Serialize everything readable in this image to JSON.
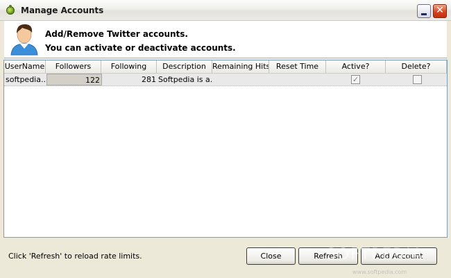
{
  "window": {
    "title": "Manage Accounts"
  },
  "header": {
    "line1": "Add/Remove Twitter accounts.",
    "line2": "You can activate or deactivate accounts."
  },
  "table": {
    "columns": [
      "UserName",
      "Followers",
      "Following",
      "Description",
      "Remaining Hits",
      "Reset Time",
      "Active?",
      "Delete?"
    ],
    "rows": [
      {
        "username": "softpedia...",
        "followers": "122",
        "following": "281",
        "description": "Softpedia is a...",
        "remaining_hits": "",
        "reset_time": "",
        "active": true,
        "delete": false
      }
    ]
  },
  "footer": {
    "status": "Click 'Refresh' to reload rate limits.",
    "close_label": "Close",
    "refresh_label": "Refresh",
    "add_account_label": "Add Account"
  },
  "watermark": {
    "main": "SOFTPEDIA",
    "sub": "www.softpedia.com"
  },
  "colors": {
    "grid_border": "#7f9db9",
    "row_bg": "#e9e9e9",
    "close_button": "#d2421a"
  }
}
